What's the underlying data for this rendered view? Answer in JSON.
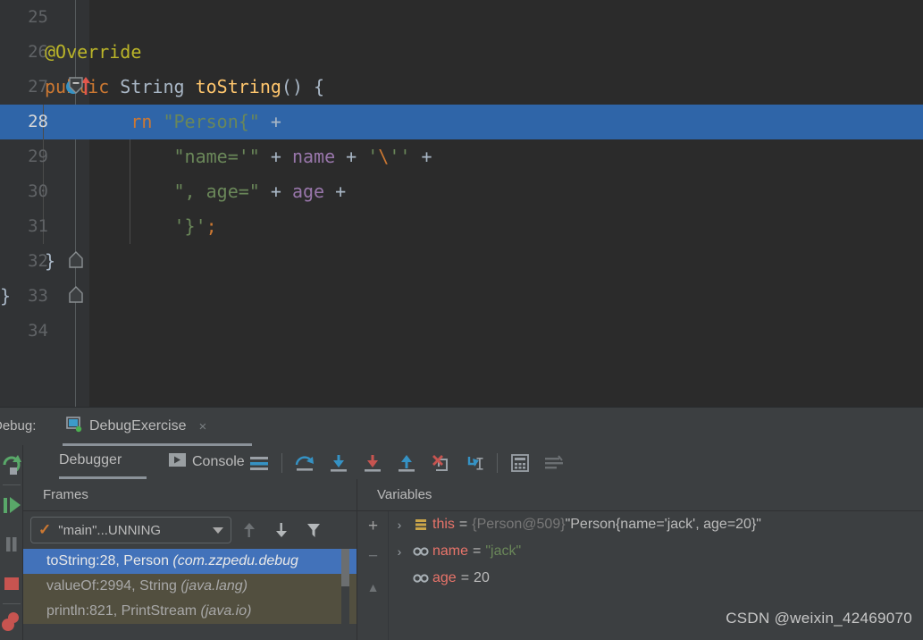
{
  "editor": {
    "lines": [
      {
        "num": "25",
        "tokens": [],
        "highlight": false
      },
      {
        "num": "26",
        "tokens": [
          {
            "t": "anno",
            "s": "@Override"
          }
        ],
        "highlight": false
      },
      {
        "num": "27",
        "tokens": [
          {
            "t": "kw",
            "s": "public "
          },
          {
            "t": "cls",
            "s": "String "
          },
          {
            "t": "mth",
            "s": "toString"
          },
          {
            "t": "pun",
            "s": "() {"
          }
        ],
        "highlight": false,
        "marker": "override-up-icon",
        "fold": "collapse"
      },
      {
        "num": "28",
        "tokens": [
          {
            "t": "kw",
            "s": "    return "
          },
          {
            "t": "str",
            "s": "\"Person{\""
          },
          {
            "t": "pun",
            "s": " +"
          }
        ],
        "highlight": true
      },
      {
        "num": "29",
        "tokens": [
          {
            "t": "str",
            "s": "            \"name='\""
          },
          {
            "t": "pun",
            "s": " + "
          },
          {
            "t": "fld",
            "s": "name"
          },
          {
            "t": "pun",
            "s": " + "
          },
          {
            "t": "str",
            "s": "'"
          },
          {
            "t": "esc",
            "s": "\\"
          },
          {
            "t": "str",
            "s": "''"
          },
          {
            "t": "pun",
            "s": " +"
          }
        ],
        "highlight": false
      },
      {
        "num": "30",
        "tokens": [
          {
            "t": "str",
            "s": "            \", age=\""
          },
          {
            "t": "pun",
            "s": " + "
          },
          {
            "t": "fld",
            "s": "age"
          },
          {
            "t": "pun",
            "s": " +"
          }
        ],
        "highlight": false
      },
      {
        "num": "31",
        "tokens": [
          {
            "t": "str",
            "s": "            '}'"
          },
          {
            "t": "kw",
            "s": ";"
          }
        ],
        "highlight": false
      },
      {
        "num": "32",
        "tokens": [
          {
            "t": "pun",
            "s": "}"
          }
        ],
        "highlight": false,
        "fold": "end"
      },
      {
        "num": "33",
        "tokens": [
          {
            "t": "pun",
            "s": "}"
          }
        ],
        "highlight": false,
        "fold": "end-outer",
        "outdent": true
      },
      {
        "num": "34",
        "tokens": [],
        "highlight": false
      }
    ]
  },
  "debug": {
    "panel_label": "Debug:",
    "run_config_tab": "DebugExercise",
    "tab_close": "×",
    "tabs": [
      {
        "label": "Debugger",
        "icon": "",
        "active": true
      },
      {
        "label": "Console",
        "icon": "console-play-icon",
        "active": false
      }
    ],
    "toolbar": [
      {
        "name": "show-execution-point-icon",
        "title": "Show Execution Point"
      },
      {
        "name": "step-over-icon",
        "title": "Step Over"
      },
      {
        "name": "step-into-icon",
        "title": "Step Into"
      },
      {
        "name": "force-step-into-icon",
        "title": "Force Step Into"
      },
      {
        "name": "step-out-icon",
        "title": "Step Out"
      },
      {
        "name": "drop-frame-icon",
        "title": "Drop Frame"
      },
      {
        "name": "run-to-cursor-icon",
        "title": "Run to Cursor"
      },
      {
        "name": "evaluate-expression-icon",
        "title": "Evaluate Expression"
      },
      {
        "name": "layout-settings-icon",
        "title": "Settings"
      }
    ],
    "left_strip": [
      {
        "name": "rerun-icon",
        "title": "Rerun"
      },
      {
        "name": "resume-program-icon",
        "title": "Resume Program"
      },
      {
        "name": "pause-program-icon",
        "title": "Pause Program"
      },
      {
        "name": "stop-icon",
        "title": "Stop"
      },
      {
        "name": "mute-breakpoints-icon",
        "title": "Mute Breakpoints"
      }
    ],
    "frames": {
      "title": "Frames",
      "thread_selector": "\"main\"...UNNING",
      "buttons": [
        {
          "name": "frames-up-button",
          "glyph": "↑"
        },
        {
          "name": "frames-down-button",
          "glyph": "↓"
        },
        {
          "name": "frames-filter-button",
          "glyph": "filter-icon"
        }
      ],
      "rows": [
        {
          "method": "toString:28, Person ",
          "pkg": "(com.zzpedu.debug",
          "selected": true
        },
        {
          "method": "valueOf:2994, String ",
          "pkg": "(java.lang)",
          "selected": false
        },
        {
          "method": "println:821, PrintStream ",
          "pkg": "(java.io)",
          "selected": false
        }
      ]
    },
    "variables": {
      "title": "Variables",
      "side_buttons": [
        {
          "name": "add-watch-button",
          "glyph": "+"
        },
        {
          "name": "remove-watch-button",
          "glyph": "−"
        },
        {
          "name": "watch-up-button",
          "glyph": "▲"
        }
      ],
      "rows": [
        {
          "expandable": true,
          "icon": "object-field-icon",
          "name": "this",
          "ref": "{Person@509}",
          "value": "\"Person{name='jack', age=20}\"",
          "value_type": "plain"
        },
        {
          "expandable": true,
          "icon": "field-icon",
          "name": "name",
          "ref": "",
          "value": "\"jack\"",
          "value_type": "string"
        },
        {
          "expandable": false,
          "icon": "field-icon",
          "name": "age",
          "ref": "",
          "value": "20",
          "value_type": "plain"
        }
      ]
    }
  },
  "watermark": "CSDN @weixin_42469070"
}
